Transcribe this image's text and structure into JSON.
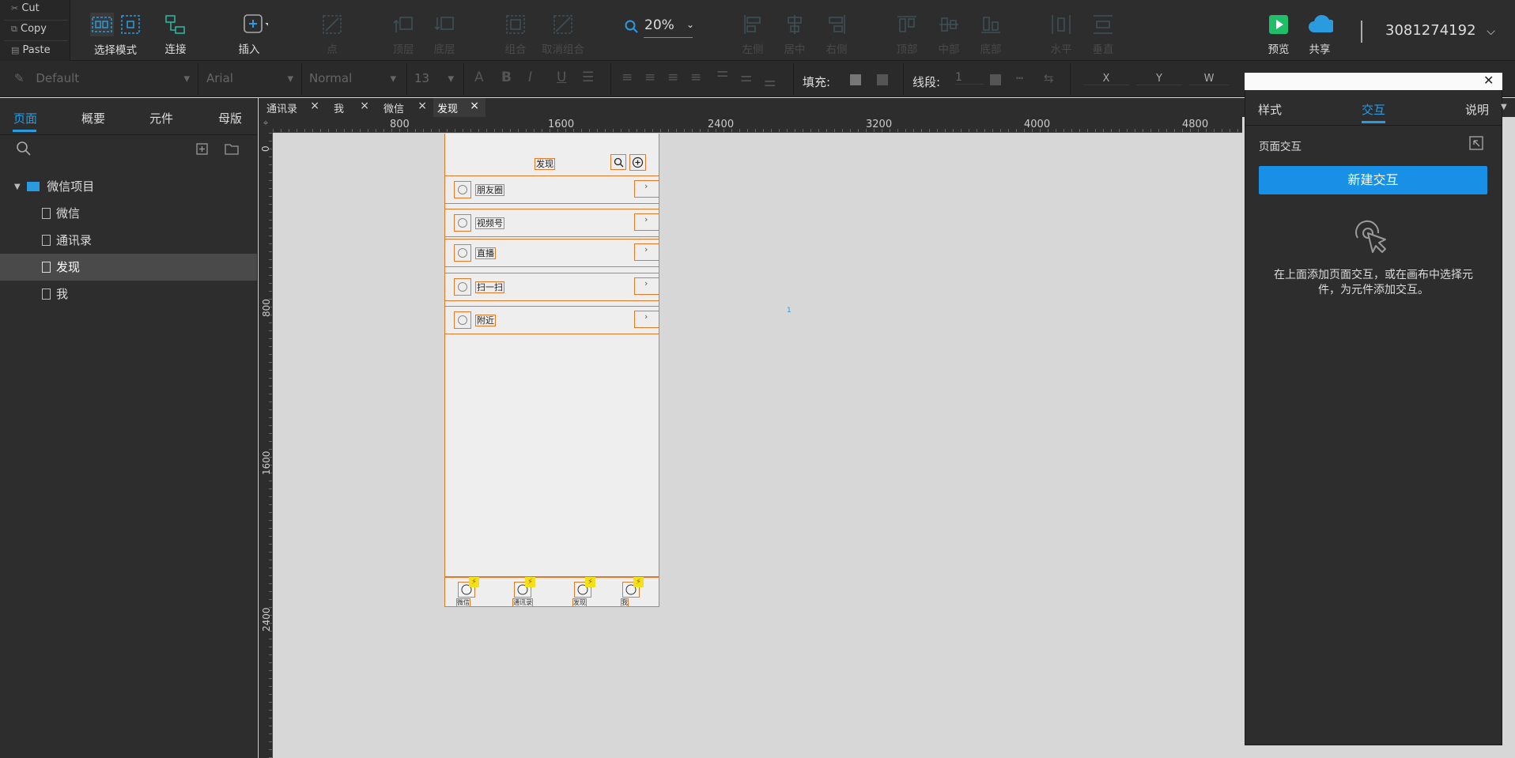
{
  "clipboard": {
    "cut": "Cut",
    "copy": "Copy",
    "paste": "Paste"
  },
  "toolbar": {
    "select_mode": "选择模式",
    "connect": "连接",
    "insert": "插入",
    "point": "点",
    "top_layer": "顶层",
    "bottom_layer": "底层",
    "group": "组合",
    "ungroup": "取消组合",
    "zoom": "20%",
    "align_left": "左侧",
    "align_center": "居中",
    "align_right": "右侧",
    "align_top": "顶部",
    "align_middle": "中部",
    "align_bottom": "底部",
    "dist_h": "水平",
    "dist_v": "垂直",
    "preview": "预览",
    "share": "共享",
    "user": "3081274192"
  },
  "format": {
    "style": "Default",
    "font": "Arial",
    "weight": "Normal",
    "size": "13",
    "fill": "填充:",
    "line": "线段:",
    "line_value": "1",
    "x": "X",
    "y": "Y",
    "w": "W"
  },
  "left_tabs": [
    "页面",
    "概要",
    "元件",
    "母版"
  ],
  "tree": {
    "root": "微信项目",
    "pages": [
      "微信",
      "通讯录",
      "发现",
      "我"
    ],
    "selected": 2
  },
  "doc_tabs": [
    "通讯录",
    "我",
    "微信",
    "发现"
  ],
  "ruler": {
    "h": [
      "800",
      "1600",
      "2400",
      "3200",
      "4000",
      "4800"
    ],
    "v": [
      "0",
      "800",
      "1600",
      "2400"
    ]
  },
  "phone": {
    "title": "发现",
    "items": [
      "朋友圈",
      "视频号",
      "直播",
      "扫一扫",
      "附近"
    ],
    "tabbar": [
      "微信",
      "通讯录",
      "发现",
      "我"
    ]
  },
  "canvas_mark": "1",
  "right_panel": {
    "tabs": [
      "样式",
      "交互",
      "说明"
    ],
    "section": "页面交互",
    "button": "新建交互",
    "hint": "在上面添加页面交互，或在画布中选择元件，为元件添加交互。"
  },
  "colors": {
    "accent": "#1890e6",
    "selection": "#e07a2a"
  }
}
